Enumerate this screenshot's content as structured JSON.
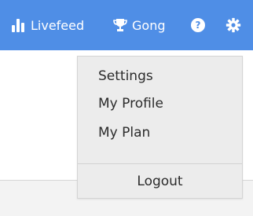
{
  "topbar": {
    "background": "#4f8ee6",
    "livefeed": {
      "icon": "bar-chart-icon",
      "label": "Livefeed"
    },
    "gong": {
      "icon": "trophy-icon",
      "label": "Gong"
    },
    "help": {
      "icon": "help-icon",
      "symbol": "?"
    },
    "settings": {
      "icon": "gear-icon"
    }
  },
  "dropdown": {
    "items": [
      {
        "label": "Settings"
      },
      {
        "label": "My Profile"
      },
      {
        "label": "My Plan"
      }
    ],
    "logout_label": "Logout"
  }
}
